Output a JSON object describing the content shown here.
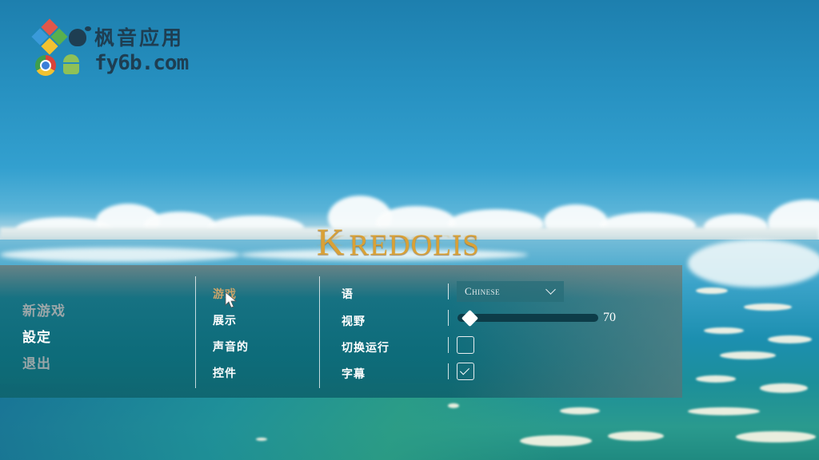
{
  "watermark": {
    "title": "枫音应用",
    "url": "fy6b.com",
    "icons": [
      "windows-icon",
      "apple-icon",
      "chrome-icon",
      "android-icon"
    ]
  },
  "game_logo": {
    "initial_k": "K",
    "initial_r": "R",
    "rest": "EDOLIS",
    "full": "KREDOLIS",
    "color": "#d9a136"
  },
  "main_menu": {
    "items": [
      {
        "label": "新游戏",
        "state": "inactive",
        "color": "#9aa6a8"
      },
      {
        "label": "設定",
        "state": "active",
        "color": "#ffffff"
      },
      {
        "label": "退出",
        "state": "inactive",
        "color": "#9aa6a8"
      }
    ]
  },
  "settings_tabs": {
    "items": [
      {
        "label": "游戏",
        "state": "selected",
        "color": "#c9a46a"
      },
      {
        "label": "展示",
        "state": "normal"
      },
      {
        "label": "声音的",
        "state": "normal"
      },
      {
        "label": "控件",
        "state": "normal"
      }
    ]
  },
  "game_settings": {
    "language": {
      "label": "语",
      "value": "Chinese"
    },
    "fov": {
      "label": "视野",
      "value": 70,
      "slider_fraction": 0.05
    },
    "toggle_run": {
      "label": "切换运行",
      "checked": false
    },
    "subtitles": {
      "label": "字幕",
      "checked": true
    }
  },
  "colors": {
    "accent_gold": "#d9a136",
    "panel_teal": "#0c6976",
    "slider_track": "#0d3c48"
  }
}
